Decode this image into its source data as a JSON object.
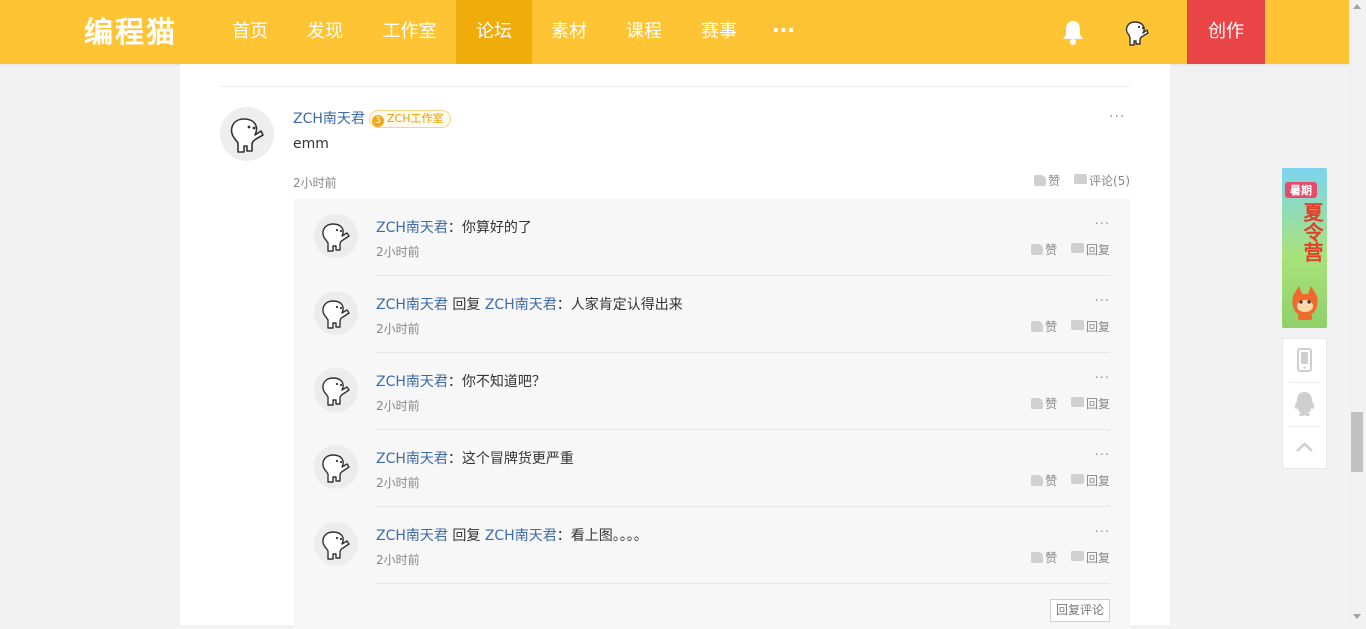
{
  "nav": {
    "logo": "编程猫",
    "items": [
      {
        "label": "首页",
        "active": false
      },
      {
        "label": "发现",
        "active": false
      },
      {
        "label": "工作室",
        "active": false
      },
      {
        "label": "论坛",
        "active": true
      },
      {
        "label": "素材",
        "active": false
      },
      {
        "label": "课程",
        "active": false
      },
      {
        "label": "赛事",
        "active": false
      }
    ],
    "more": "···",
    "create": "创作",
    "colors": {
      "bar": "#fec433",
      "active": "#f0ac0a",
      "create": "#e94546"
    }
  },
  "post": {
    "author": "ZCH南天君",
    "badge_level": "3",
    "badge_text": "ZCH工作室",
    "more": "···",
    "text": "emm",
    "time": "2小时前",
    "like_label": "赞",
    "comment_label": "评论(5)"
  },
  "replies": [
    {
      "author": "ZCH南天君",
      "reply_word": "",
      "target": "",
      "sep": "：",
      "text": "你算好的了",
      "time": "2小时前"
    },
    {
      "author": "ZCH南天君",
      "reply_word": "回复",
      "target": "ZCH南天君",
      "sep": "：",
      "text": "人家肯定认得出来",
      "time": "2小时前"
    },
    {
      "author": "ZCH南天君",
      "reply_word": "",
      "target": "",
      "sep": "：",
      "text": "你不知道吧？",
      "time": "2小时前"
    },
    {
      "author": "ZCH南天君",
      "reply_word": "",
      "target": "",
      "sep": "：",
      "text": "这个冒牌货更严重",
      "time": "2小时前"
    },
    {
      "author": "ZCH南天君",
      "reply_word": "回复",
      "target": "ZCH南天君",
      "sep": "：",
      "text": "看上图。。。。",
      "time": "2小时前"
    }
  ],
  "reply_actions": {
    "like": "赞",
    "reply": "回复",
    "more": "···"
  },
  "reply_comment_button": "回复评论",
  "promo": {
    "small": "暑期",
    "big": "夏令营"
  },
  "side_tools": [
    "mobile-icon",
    "qq-icon",
    "back-to-top-icon"
  ]
}
